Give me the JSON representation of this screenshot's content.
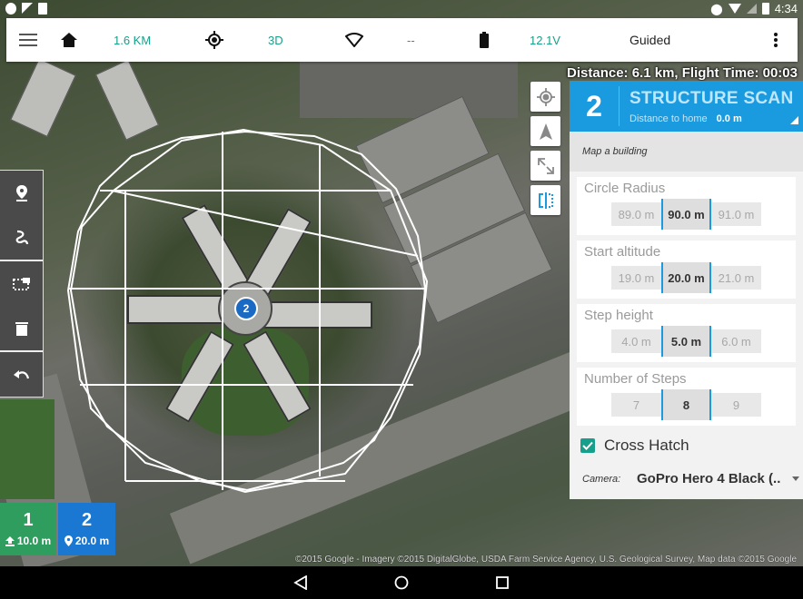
{
  "status_bar": {
    "time": "4:34",
    "left_icons": [
      "circle-icon",
      "signal-icon",
      "clipboard-check-icon"
    ],
    "right_icons": [
      "location-icon",
      "wifi-icon",
      "no-signal-icon",
      "battery-charging-icon"
    ]
  },
  "toolbar": {
    "menu_icon": "hamburger-menu-icon",
    "home_icon": "home-icon",
    "home_distance": "1.6 KM",
    "gps_icon": "gps-crosshair-icon",
    "gps_fix": "3D",
    "signal_icon": "signal-strength-icon",
    "signal_value": "--",
    "battery_icon": "battery-icon",
    "battery_voltage": "12.1V",
    "flight_mode": "Guided",
    "overflow_icon": "more-vert-icon"
  },
  "flight_info": "Distance: 6.1 km, Flight Time: 00:03",
  "edit_tools": {
    "groups": [
      [
        {
          "name": "waypoint-tool",
          "icon": "marker-icon"
        },
        {
          "name": "spline-tool",
          "icon": "spline-icon"
        }
      ],
      [
        {
          "name": "select-tool",
          "icon": "selection-icon"
        },
        {
          "name": "delete-tool",
          "icon": "trash-icon"
        }
      ],
      [
        {
          "name": "undo-tool",
          "icon": "undo-icon"
        }
      ]
    ]
  },
  "map_buttons": [
    {
      "name": "my-location-button",
      "icon": "my-location-icon"
    },
    {
      "name": "drone-location-button",
      "icon": "navigation-arrow-icon"
    },
    {
      "name": "zoom-to-fit-button",
      "icon": "expand-icon"
    },
    {
      "name": "split-view-button",
      "icon": "split-icon"
    }
  ],
  "mission_item": {
    "number": "2",
    "title": "STRUCTURE SCAN",
    "distance_label": "Distance to home",
    "distance_value": "0.0 m",
    "description": "Map a building"
  },
  "params": [
    {
      "label": "Circle Radius",
      "options": [
        "89.0 m",
        "90.0 m",
        "91.0 m"
      ],
      "selected": 1
    },
    {
      "label": "Start altitude",
      "options": [
        "19.0 m",
        "20.0 m",
        "21.0 m"
      ],
      "selected": 1
    },
    {
      "label": "Step height",
      "options": [
        "4.0 m",
        "5.0 m",
        "6.0 m"
      ],
      "selected": 1
    },
    {
      "label": "Number of Steps",
      "options": [
        "7",
        "8",
        "9"
      ],
      "selected": 1
    }
  ],
  "cross_hatch": {
    "label": "Cross Hatch",
    "checked": true
  },
  "camera": {
    "label": "Camera:",
    "value": "GoPro Hero 4 Black (.."
  },
  "waypoints": [
    {
      "number": "1",
      "altitude": "10.0 m",
      "icon": "takeoff-icon",
      "color": "#2e9d5e"
    },
    {
      "number": "2",
      "altitude": "20.0 m",
      "icon": "location-pin-icon",
      "color": "#1a78d2"
    }
  ],
  "map_marker": {
    "label": "2"
  },
  "attribution": "©2015 Google - Imagery ©2015 DigitalGlobe, USDA Farm Service Agency, U.S. Geological Survey, Map data ©2015 Google",
  "nav_bar": {
    "back_icon": "back-icon",
    "home_icon": "home-circle-icon",
    "recents_icon": "recents-icon"
  },
  "colors": {
    "accent_blue": "#1a9be0",
    "teal": "#16a08c",
    "takeoff_green": "#2e9d5e",
    "waypoint_blue": "#1a78d2"
  }
}
